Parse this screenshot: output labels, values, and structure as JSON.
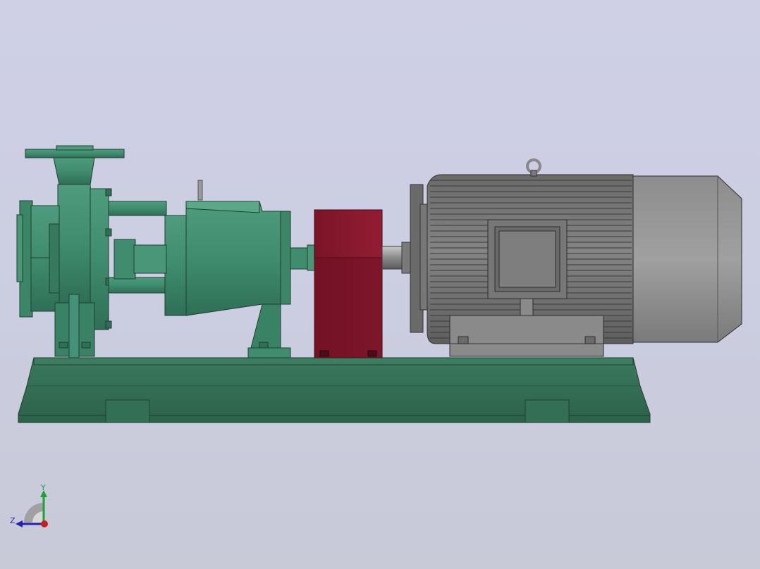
{
  "viewport": {
    "background_top": "#cfd0e6",
    "background_bottom": "#c8cad8"
  },
  "model": {
    "pump_color": "#3f8c6e",
    "base_color": "#2f6a52",
    "coupling_guard_color": "#8b1c30",
    "motor_color": "#7a7a7a",
    "motor_fan_cover_color": "#909090"
  },
  "triad": {
    "y_label": "Y",
    "z_label": "Z",
    "y_color": "#1fa13a",
    "z_color": "#2323b0",
    "x_color": "#c81e1e"
  }
}
